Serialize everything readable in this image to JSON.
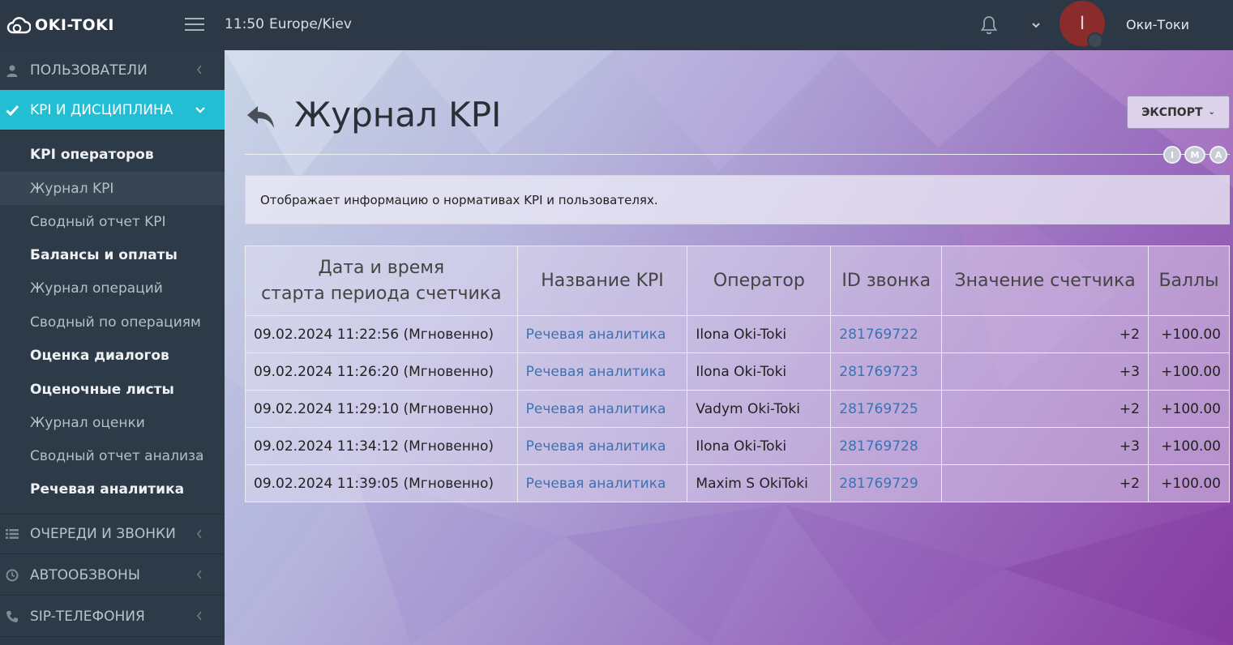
{
  "app": {
    "name": "OKI-TOKI",
    "time": "11:50",
    "timezone": "Europe/Kiev",
    "user_name": "Оки-Токи",
    "avatar_letter": "I"
  },
  "sidebar": {
    "sections": [
      {
        "label": "ПОЛЬЗОВАТЕЛИ",
        "icon": "user-icon",
        "active": false
      },
      {
        "label": "KPI И ДИСЦИПЛИНА",
        "icon": "check-icon",
        "active": true
      },
      {
        "label": "ОЧЕРЕДИ И ЗВОНКИ",
        "icon": "list-icon",
        "active": false
      },
      {
        "label": "АВТООБЗВОНЫ",
        "icon": "clock-icon",
        "active": false
      },
      {
        "label": "SIP-ТЕЛЕФОНИЯ",
        "icon": "phone-icon",
        "active": false
      }
    ],
    "items": [
      {
        "label": "KPI операторов",
        "bold": true
      },
      {
        "label": "Журнал KPI",
        "current": true
      },
      {
        "label": "Сводный отчет KPI"
      },
      {
        "label": "Балансы и оплаты",
        "bold": true
      },
      {
        "label": "Журнал операций"
      },
      {
        "label": "Сводный по операциям"
      },
      {
        "label": "Оценка диалогов",
        "bold": true
      },
      {
        "label": "Оценочные листы",
        "bold": true
      },
      {
        "label": "Журнал оценки"
      },
      {
        "label": "Сводный отчет анализа",
        "has_submenu": true
      },
      {
        "label": "Речевая аналитика",
        "bold": true
      }
    ]
  },
  "page": {
    "title": "Журнал KPI",
    "export_label": "ЭКСПОРТ",
    "view_modes": [
      "I",
      "M",
      "A"
    ],
    "info_text": "Отображает информацию о нормативах KPI и пользователях."
  },
  "table": {
    "headers": {
      "datetime_line1": "Дата и время",
      "datetime_line2": "старта периода счетчика",
      "kpi_name": "Название KPI",
      "operator": "Оператор",
      "call_id": "ID звонка",
      "counter_value": "Значение счетчика",
      "points": "Баллы"
    },
    "rows": [
      {
        "datetime": "09.02.2024 11:22:56 (Мгновенно)",
        "kpi": "Речевая аналитика",
        "operator": "Ilona Oki-Toki",
        "call_id": "281769722",
        "counter": "+2",
        "points": "+100.00"
      },
      {
        "datetime": "09.02.2024 11:26:20 (Мгновенно)",
        "kpi": "Речевая аналитика",
        "operator": "Ilona Oki-Toki",
        "call_id": "281769723",
        "counter": "+3",
        "points": "+100.00"
      },
      {
        "datetime": "09.02.2024 11:29:10 (Мгновенно)",
        "kpi": "Речевая аналитика",
        "operator": "Vadym Oki-Toki",
        "call_id": "281769725",
        "counter": "+2",
        "points": "+100.00"
      },
      {
        "datetime": "09.02.2024 11:34:12 (Мгновенно)",
        "kpi": "Речевая аналитика",
        "operator": "Ilona Oki-Toki",
        "call_id": "281769728",
        "counter": "+3",
        "points": "+100.00"
      },
      {
        "datetime": "09.02.2024 11:39:05 (Мгновенно)",
        "kpi": "Речевая аналитика",
        "operator": "Maxim S OkiToki",
        "call_id": "281769729",
        "counter": "+2",
        "points": "+100.00"
      }
    ]
  },
  "colors": {
    "topbar": "#2c3845",
    "sidebar": "#2d3a47",
    "accent": "#22bed3",
    "link": "#3c72b2"
  }
}
